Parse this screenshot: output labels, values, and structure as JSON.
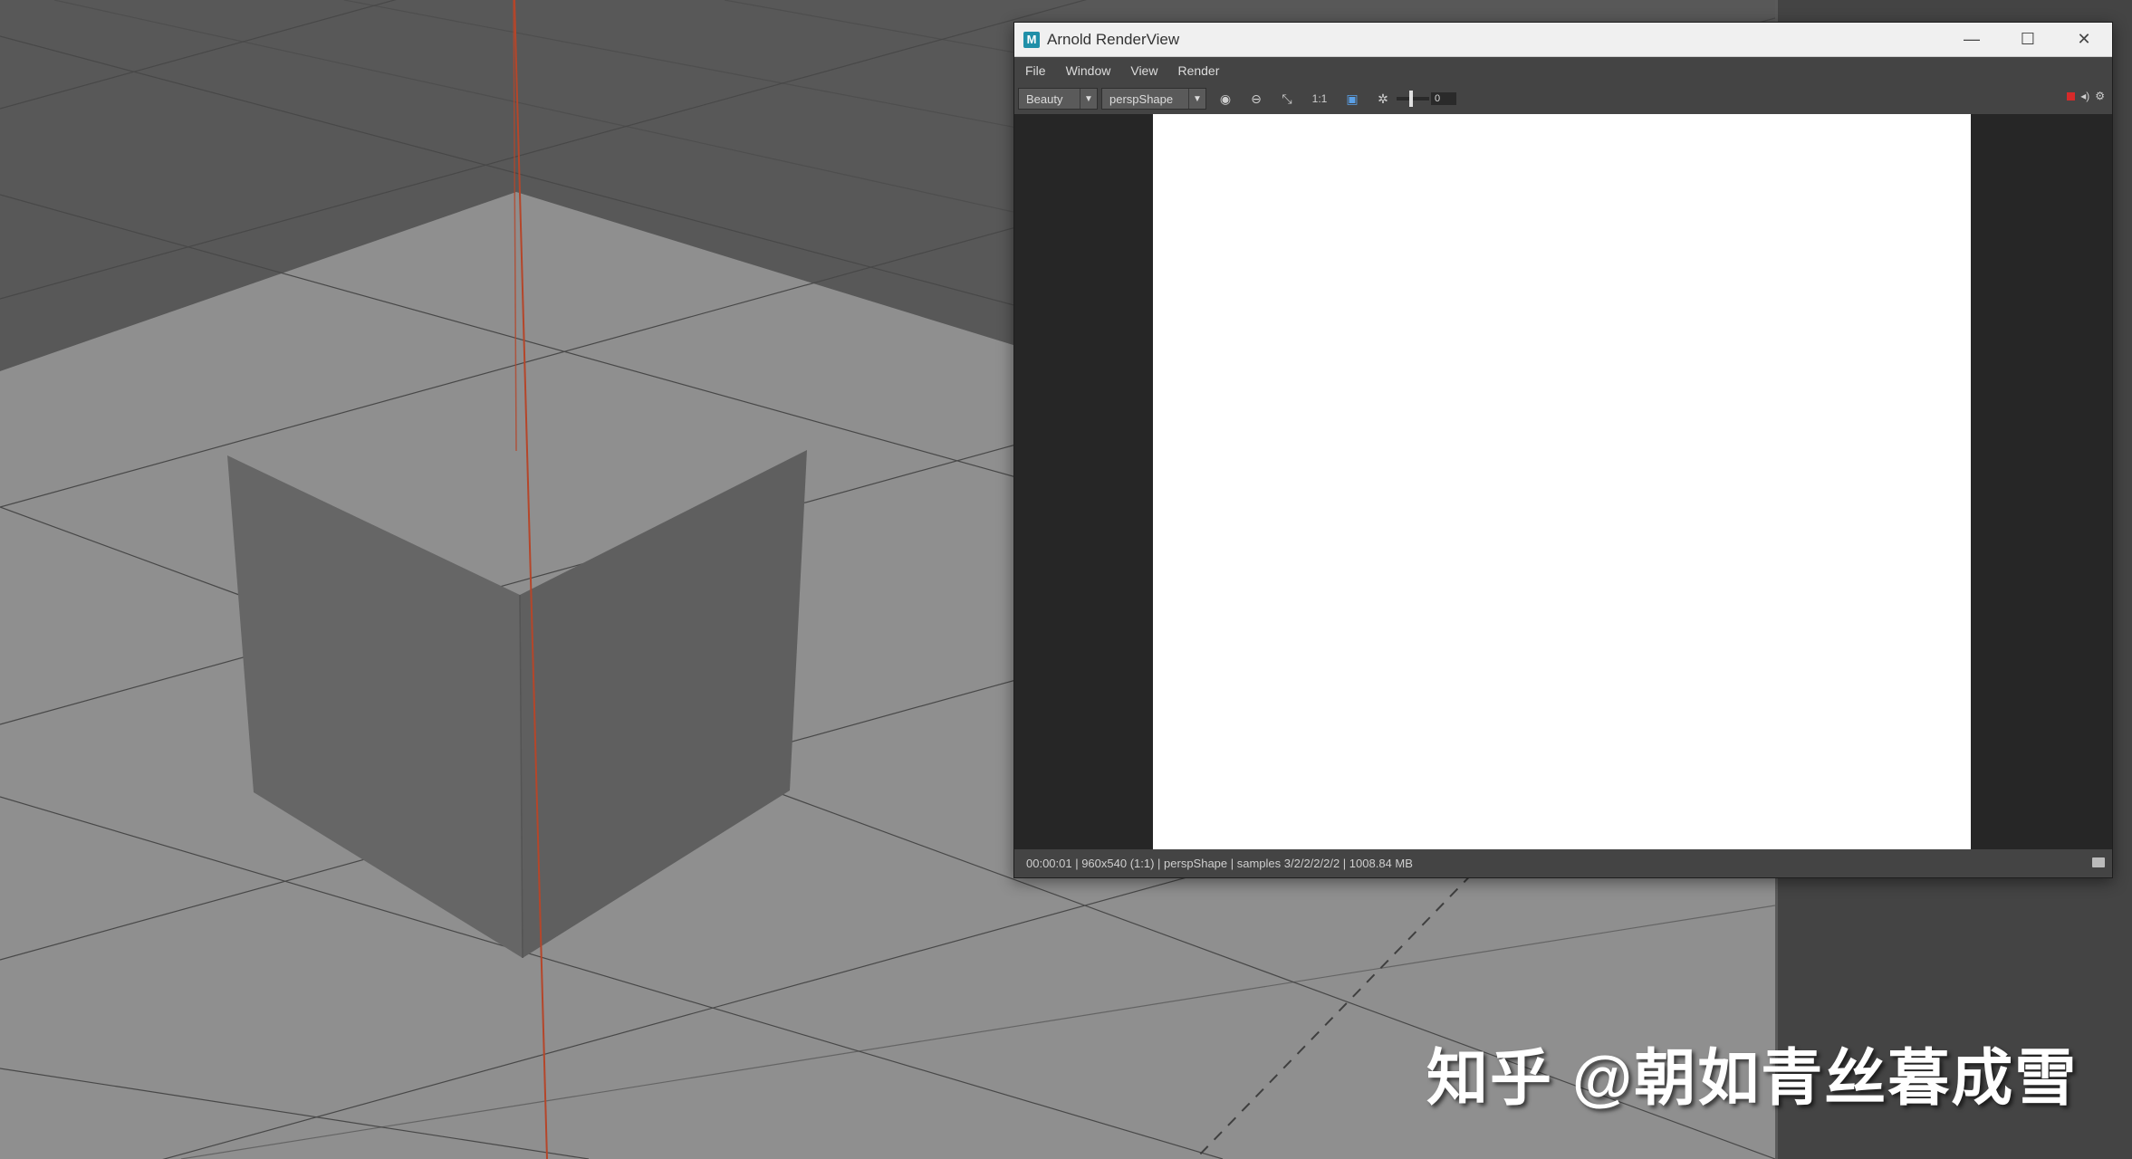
{
  "window": {
    "title": "Arnold RenderView",
    "app_icon": "M",
    "controls": [
      "—",
      "☐",
      "✕"
    ]
  },
  "menu": [
    "File",
    "Window",
    "View",
    "Render"
  ],
  "toolbar": {
    "aov": "Beauty",
    "camera": "perspShape",
    "ratio_label": "1:1",
    "slider_value": "0",
    "icons": [
      "display-icon",
      "channels-icon",
      "refresh-icon",
      "ratio-icon",
      "crop-region-icon",
      "exposure-icon"
    ]
  },
  "status": {
    "text": "00:00:01 | 960x540 (1:1) | perspShape  | samples 3/2/2/2/2/2 | 1008.84 MB"
  },
  "watermark": "知乎 @朝如青丝暮成雪",
  "colors": {
    "viewport_bg": "#585858",
    "ground": "#8f8f8f",
    "cube_left": "#666666",
    "cube_right": "#5f5f5f",
    "cube_top": "#939393",
    "axis_red": "#b5462a",
    "render_bg": "#ffffff",
    "panel": "#444444"
  }
}
